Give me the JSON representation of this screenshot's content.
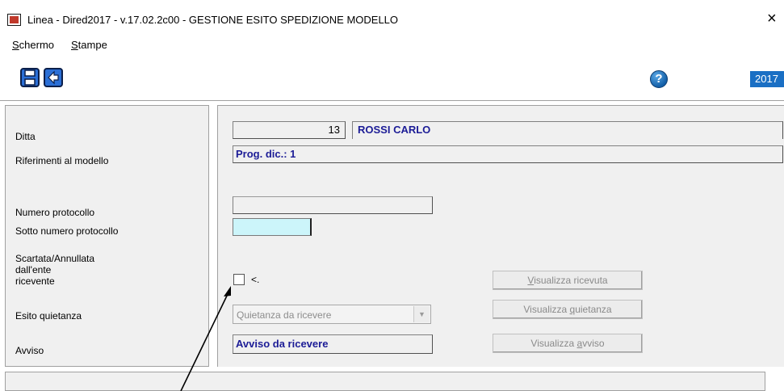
{
  "window": {
    "title": "Linea - Dired2017 - v.17.02.2c00 - GESTIONE ESITO SPEDIZIONE MODELLO",
    "close_glyph": "×"
  },
  "menu": {
    "items": [
      {
        "label": "Schermo",
        "mnemonic": "S",
        "rest": "chermo"
      },
      {
        "label": "Stampe",
        "mnemonic": "S",
        "rest": "tampe"
      }
    ]
  },
  "toolbar": {
    "save_icon": "save-icon",
    "back_icon": "back-icon",
    "help_glyph": "?",
    "year": "2017"
  },
  "labels": {
    "ditta": "Ditta",
    "riferimenti": "Riferimenti al modello",
    "numero_protocollo": "Numero protocollo",
    "sotto_numero": "Sotto numero protocollo",
    "scartata_1": "Scartata/Annullata",
    "scartata_2": "dall'ente",
    "scartata_3": "ricevente",
    "esito_quietanza": "Esito quietanza",
    "avviso": "Avviso"
  },
  "fields": {
    "ditta_code": "13",
    "ditta_name": "ROSSI CARLO",
    "prog_dic": "Prog. dic.: 1",
    "numero_protocollo": "",
    "sotto_numero": "",
    "checkbox_label": "<.",
    "esito_quietanza": "Quietanza da ricevere",
    "avviso": "Avviso da ricevere"
  },
  "buttons": {
    "visualizza_ricevuta": {
      "pre": "",
      "mn": "V",
      "post": "isualizza ricevuta"
    },
    "visualizza_quietanza": {
      "pre": "Visualizza ",
      "mn": "q",
      "post": "uietanza"
    },
    "visualizza_avviso": {
      "pre": "Visualizza ",
      "mn": "a",
      "post": "vviso"
    }
  },
  "colors": {
    "accent_blue": "#1a6fc4",
    "value_blue": "#1c1c96",
    "input_focus": "#ccf5fa"
  }
}
